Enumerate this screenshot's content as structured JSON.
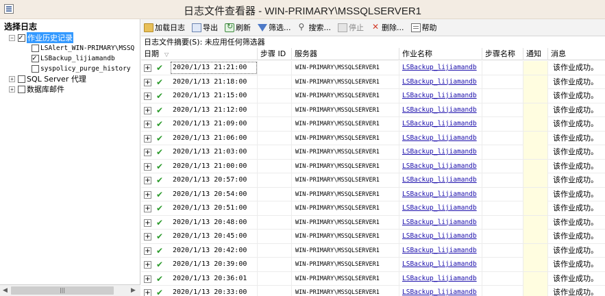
{
  "window": {
    "title": "日志文件查看器 - WIN-PRIMARY\\MSSQLSERVER1"
  },
  "left_pane": {
    "header": "选择日志",
    "tree": [
      {
        "label": "作业历史记录",
        "checked": true,
        "expanded": true,
        "selected": true
      },
      {
        "label": "LSAlert_WIN-PRIMARY\\MSSQ",
        "checked": false
      },
      {
        "label": "LSBackup_lijiamandb",
        "checked": true
      },
      {
        "label": "syspolicy_purge_history",
        "checked": false
      },
      {
        "label": "SQL Server 代理",
        "checked": false,
        "expanded": false
      },
      {
        "label": "数据库邮件",
        "checked": false,
        "expanded": false
      }
    ]
  },
  "toolbar": {
    "load_log": "加载日志",
    "export": "导出",
    "refresh": "刷新",
    "filter": "筛选...",
    "search": "搜索...",
    "stop": "停止",
    "delete": "删除...",
    "help": "帮助"
  },
  "summary": "日志文件摘要(S): 未应用任何筛选器",
  "grid": {
    "columns": {
      "date": "日期",
      "step_id": "步骤 ID",
      "server": "服务器",
      "job_name": "作业名称",
      "step_name": "步骤名称",
      "notify": "通知",
      "message": "消息"
    },
    "rows": [
      {
        "date": "2020/1/13 21:21:00",
        "server": "WIN-PRIMARY\\MSSQLSERVER1",
        "job": "LSBackup_lijiamandb",
        "message": "该作业成功。"
      },
      {
        "date": "2020/1/13 21:18:00",
        "server": "WIN-PRIMARY\\MSSQLSERVER1",
        "job": "LSBackup_lijiamandb",
        "message": "该作业成功。"
      },
      {
        "date": "2020/1/13 21:15:00",
        "server": "WIN-PRIMARY\\MSSQLSERVER1",
        "job": "LSBackup_lijiamandb",
        "message": "该作业成功。"
      },
      {
        "date": "2020/1/13 21:12:00",
        "server": "WIN-PRIMARY\\MSSQLSERVER1",
        "job": "LSBackup_lijiamandb",
        "message": "该作业成功。"
      },
      {
        "date": "2020/1/13 21:09:00",
        "server": "WIN-PRIMARY\\MSSQLSERVER1",
        "job": "LSBackup_lijiamandb",
        "message": "该作业成功。"
      },
      {
        "date": "2020/1/13 21:06:00",
        "server": "WIN-PRIMARY\\MSSQLSERVER1",
        "job": "LSBackup_lijiamandb",
        "message": "该作业成功。"
      },
      {
        "date": "2020/1/13 21:03:00",
        "server": "WIN-PRIMARY\\MSSQLSERVER1",
        "job": "LSBackup_lijiamandb",
        "message": "该作业成功。"
      },
      {
        "date": "2020/1/13 21:00:00",
        "server": "WIN-PRIMARY\\MSSQLSERVER1",
        "job": "LSBackup_lijiamandb",
        "message": "该作业成功。"
      },
      {
        "date": "2020/1/13 20:57:00",
        "server": "WIN-PRIMARY\\MSSQLSERVER1",
        "job": "LSBackup_lijiamandb",
        "message": "该作业成功。"
      },
      {
        "date": "2020/1/13 20:54:00",
        "server": "WIN-PRIMARY\\MSSQLSERVER1",
        "job": "LSBackup_lijiamandb",
        "message": "该作业成功。"
      },
      {
        "date": "2020/1/13 20:51:00",
        "server": "WIN-PRIMARY\\MSSQLSERVER1",
        "job": "LSBackup_lijiamandb",
        "message": "该作业成功。"
      },
      {
        "date": "2020/1/13 20:48:00",
        "server": "WIN-PRIMARY\\MSSQLSERVER1",
        "job": "LSBackup_lijiamandb",
        "message": "该作业成功。"
      },
      {
        "date": "2020/1/13 20:45:00",
        "server": "WIN-PRIMARY\\MSSQLSERVER1",
        "job": "LSBackup_lijiamandb",
        "message": "该作业成功。"
      },
      {
        "date": "2020/1/13 20:42:00",
        "server": "WIN-PRIMARY\\MSSQLSERVER1",
        "job": "LSBackup_lijiamandb",
        "message": "该作业成功。"
      },
      {
        "date": "2020/1/13 20:39:00",
        "server": "WIN-PRIMARY\\MSSQLSERVER1",
        "job": "LSBackup_lijiamandb",
        "message": "该作业成功。"
      },
      {
        "date": "2020/1/13 20:36:01",
        "server": "WIN-PRIMARY\\MSSQLSERVER1",
        "job": "LSBackup_lijiamandb",
        "message": "该作业成功。"
      },
      {
        "date": "2020/1/13 20:33:00",
        "server": "WIN-PRIMARY\\MSSQLSERVER1",
        "job": "LSBackup_lijiamandb",
        "message": "该作业成功。"
      }
    ]
  }
}
